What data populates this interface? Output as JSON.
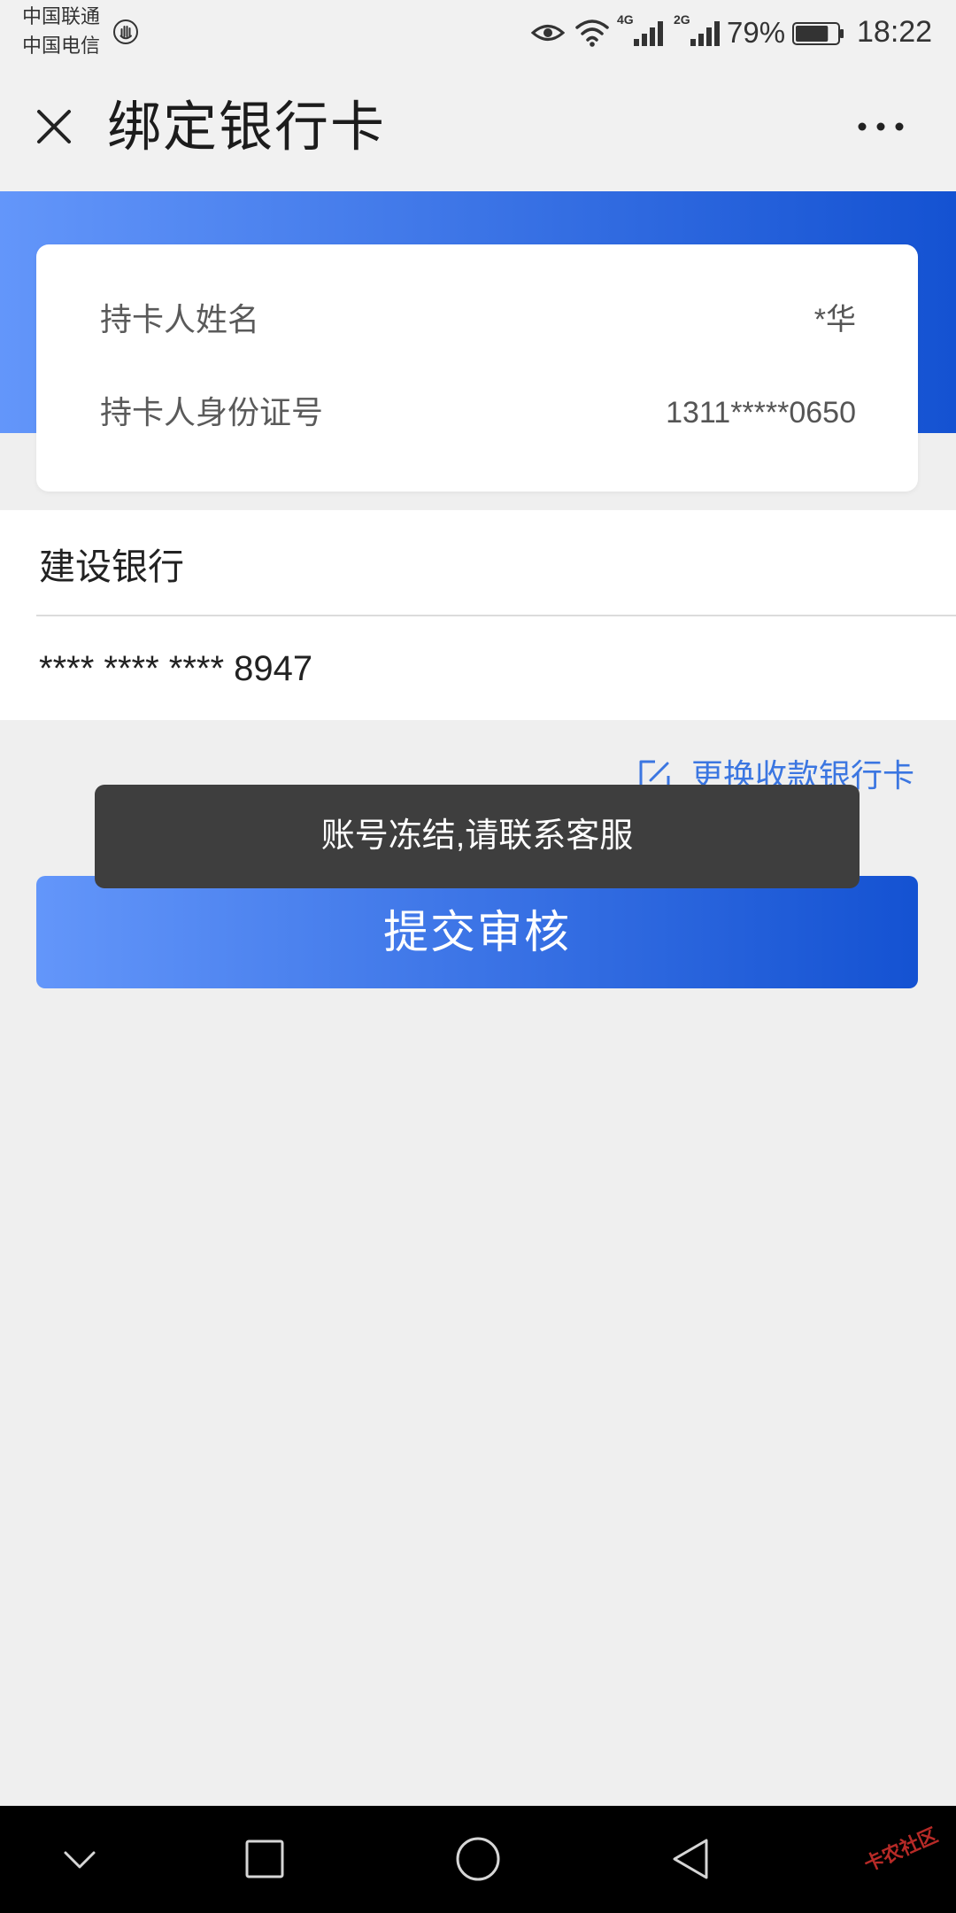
{
  "status_bar": {
    "carrier_1": "中国联通",
    "carrier_2": "中国电信",
    "network_1": "4G",
    "network_2": "2G",
    "battery_text": "79%",
    "battery_level": 0.79,
    "time": "18:22"
  },
  "header": {
    "title": "绑定银行卡"
  },
  "cardholder": {
    "name_label": "持卡人姓名",
    "name_value": "*华",
    "id_label": "持卡人身份证号",
    "id_value": "1311*****0650"
  },
  "bank_card": {
    "bank_name": "建设银行",
    "card_number": "**** **** **** 8947"
  },
  "change_card_link": "更换收款银行卡",
  "toast": "账号冻结,请联系客服",
  "submit_button": "提交审核",
  "watermark": "卡农社区",
  "icons": {
    "status": [
      "hand-icon",
      "eye-icon",
      "wifi-icon",
      "signal-icon",
      "signal-icon",
      "battery-icon"
    ],
    "header": [
      "close-icon",
      "more-icon"
    ],
    "link": "edit-icon",
    "nav": [
      "chevron-down-icon",
      "recent-apps-icon",
      "home-icon",
      "back-icon"
    ]
  },
  "colors": {
    "accent": "#3b76e1",
    "gradient_start": "#6396fa",
    "gradient_end": "#1452d2",
    "toast_bg": "#3e3e3e",
    "page_bg": "#efefef",
    "bar_bg": "#f1f1f1"
  }
}
